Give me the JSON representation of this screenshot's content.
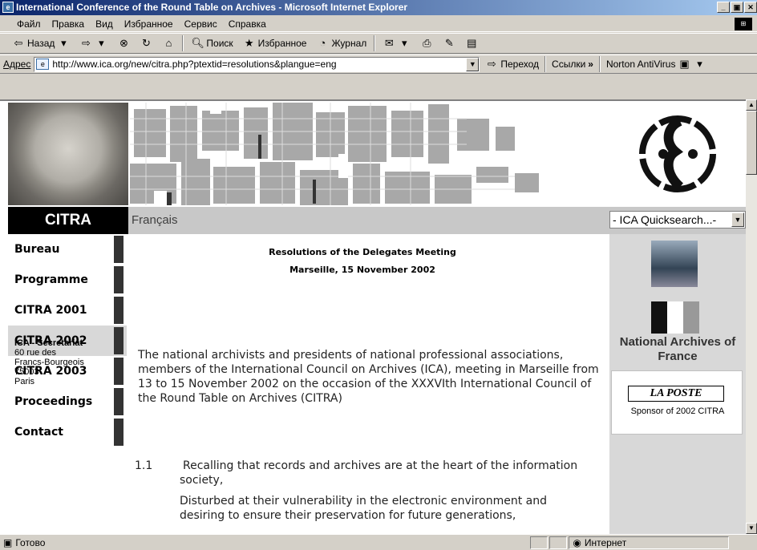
{
  "window": {
    "title": "International Conference of the Round Table on Archives - Microsoft Internet Explorer",
    "controls": [
      "_",
      "ő",
      "x"
    ]
  },
  "menu": {
    "items": [
      "Файл",
      "Правка",
      "Вид",
      "Избранное",
      "Сервис",
      "Справка"
    ]
  },
  "toolbar": {
    "back": "Назад",
    "search": "Поиск",
    "favorites": "Избранное",
    "history": "Журнал"
  },
  "address": {
    "label": "Адрес",
    "url": "http://www.ica.org/new/citra.php?ptextid=resolutions&plangue=eng",
    "go": "Переход",
    "links": "Ссылки",
    "norton": "Norton AntiVirus"
  },
  "status": {
    "text": "Готово",
    "zone": "Интернет"
  },
  "page": {
    "citra": "CITRA",
    "francais": "Français",
    "quicksearch": "- ICA Quicksearch...-",
    "nav": [
      "Bureau",
      "Programme",
      "CITRA 2001",
      "CITRA 2002",
      "CITRA 2003",
      "Proceedings",
      "Contact"
    ],
    "nav_active": "CITRA 2002",
    "secretariat": {
      "title": "ICA - Secretariat",
      "lines": [
        "60 rue des",
        "Francs-Bourgeois",
        "75003",
        "Paris"
      ]
    },
    "heading1": "Resolutions of the Delegates Meeting",
    "heading2": "Marseille, 15 November 2002",
    "intro": "The national archivists and presidents of national professional associations, members of the International Council on Archives (ICA), meeting in Marseille from 13 to 15 November 2002 on the occasion of the XXXVIth International Council of the Round Table on Archives (CITRA)",
    "item_num": "1.1",
    "item_text1": "Recalling that records and archives are at the heart of the information society,",
    "item_text2": "Disturbed at their vulnerability in the electronic environment and desiring to ensure their preservation for future generations,",
    "national_archives": "National Archives of France",
    "laposte": "LA POSTE",
    "sponsor": "Sponsor of 2002 CITRA"
  }
}
